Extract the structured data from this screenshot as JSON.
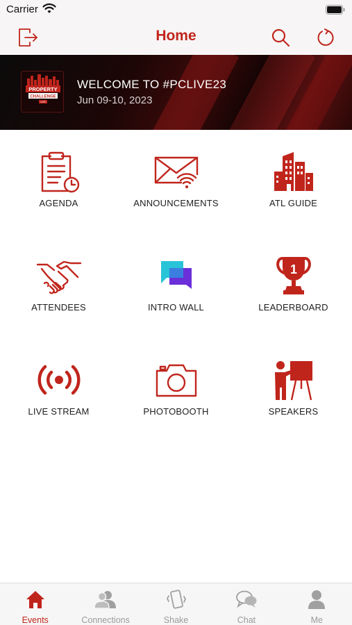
{
  "status": {
    "carrier": "Carrier"
  },
  "nav": {
    "title": "Home"
  },
  "banner": {
    "title": "WELCOME TO #PCLIVE23",
    "date": "Jun 09-10, 2023",
    "logo_text": "PROPERTY CHALLENGE LIVE"
  },
  "tiles": [
    {
      "label": "AGENDA",
      "icon": "clipboard-clock-icon"
    },
    {
      "label": "ANNOUNCEMENTS",
      "icon": "envelope-wifi-icon"
    },
    {
      "label": "ATL GUIDE",
      "icon": "buildings-icon"
    },
    {
      "label": "ATTENDEES",
      "icon": "handshake-icon"
    },
    {
      "label": "INTRO WALL",
      "icon": "chat-bubbles-icon"
    },
    {
      "label": "LEADERBOARD",
      "icon": "trophy-icon"
    },
    {
      "label": "LIVE STREAM",
      "icon": "broadcast-icon"
    },
    {
      "label": "PHOTOBOOTH",
      "icon": "camera-icon"
    },
    {
      "label": "SPEAKERS",
      "icon": "presenter-icon"
    }
  ],
  "tabs": [
    {
      "label": "Events",
      "icon": "home-icon",
      "active": true
    },
    {
      "label": "Connections",
      "icon": "people-icon",
      "active": false
    },
    {
      "label": "Shake",
      "icon": "phone-shake-icon",
      "active": false
    },
    {
      "label": "Chat",
      "icon": "chat-icon",
      "active": false
    },
    {
      "label": "Me",
      "icon": "person-icon",
      "active": false
    }
  ],
  "colors": {
    "accent": "#c0251c",
    "inactive": "#9a9a9a",
    "intro_cyan": "#29c4d8",
    "intro_purple": "#6a2fd8"
  }
}
